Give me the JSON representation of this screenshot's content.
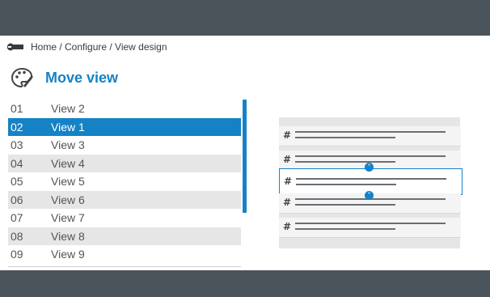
{
  "breadcrumb": {
    "text": "Home / Configure / View design",
    "icon": "wrench-icon"
  },
  "page": {
    "title": "Move view",
    "icon": "palette-icon",
    "accent": "#1582c6"
  },
  "views": [
    {
      "num": "01",
      "label": "View 2"
    },
    {
      "num": "02",
      "label": "View 1"
    },
    {
      "num": "03",
      "label": "View 3"
    },
    {
      "num": "04",
      "label": "View 4"
    },
    {
      "num": "05",
      "label": "View 5"
    },
    {
      "num": "06",
      "label": "View 6"
    },
    {
      "num": "07",
      "label": "View 7"
    },
    {
      "num": "08",
      "label": "View 8"
    },
    {
      "num": "09",
      "label": "View 9"
    }
  ],
  "selected_index": 1,
  "preview": {
    "cards": [
      {
        "symbol": "#"
      },
      {
        "symbol": "#"
      },
      {
        "symbol": "#"
      },
      {
        "symbol": "#"
      },
      {
        "symbol": "#"
      }
    ],
    "active_card": 2,
    "move_up_icon": "chevron-up-icon",
    "move_down_icon": "chevron-down-icon"
  }
}
